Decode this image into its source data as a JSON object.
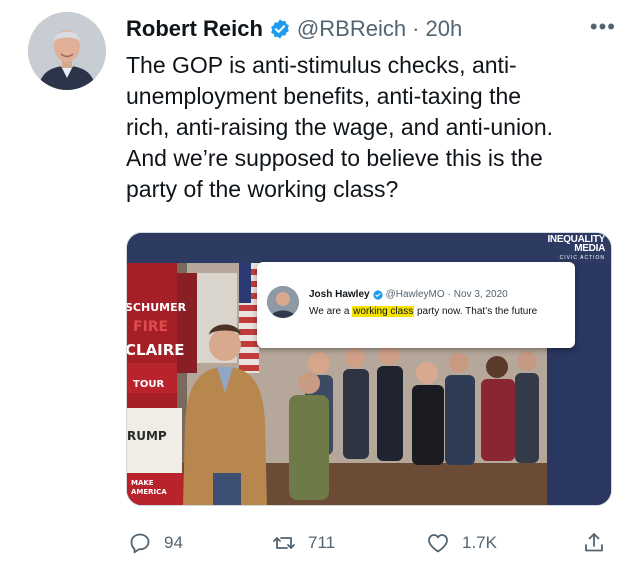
{
  "author": {
    "name": "Robert Reich",
    "handle": "@RBReich",
    "time": "· 20h",
    "verified": true
  },
  "tweet": {
    "text": "The GOP is anti-stimulus checks, anti-\nunemployment benefits, anti-taxing the\nrich, anti-raising the wage, and anti-union.\nAnd we’re supposed to believe this is the\nparty of the working class?"
  },
  "media": {
    "watermark_line1": "INEQUALITY",
    "watermark_line2": "MEDIA",
    "watermark_line3": "CIVIC ACTION",
    "signs": {
      "schumer": "SCHUMER",
      "fire": "FIRE",
      "claire": "CLAIRE",
      "tour": "TOUR",
      "rump": "RUMP",
      "make_america": "MAKE\nAMERICA"
    },
    "embedded_tweet": {
      "name": "Josh Hawley",
      "handle": "@HawleyMO",
      "date": "· Nov 3, 2020",
      "text_before": "We are a ",
      "text_highlight": "working class",
      "text_after": " party now. That’s the future"
    }
  },
  "actions": {
    "replies": "94",
    "retweets": "711",
    "likes": "1.7K"
  },
  "colors": {
    "verified": "#1d9bf0",
    "highlight": "#f5e200",
    "secondary_text": "#536471"
  },
  "icons": [
    "verified-badge-icon",
    "more-icon",
    "reply-icon",
    "retweet-icon",
    "like-icon",
    "share-icon"
  ]
}
